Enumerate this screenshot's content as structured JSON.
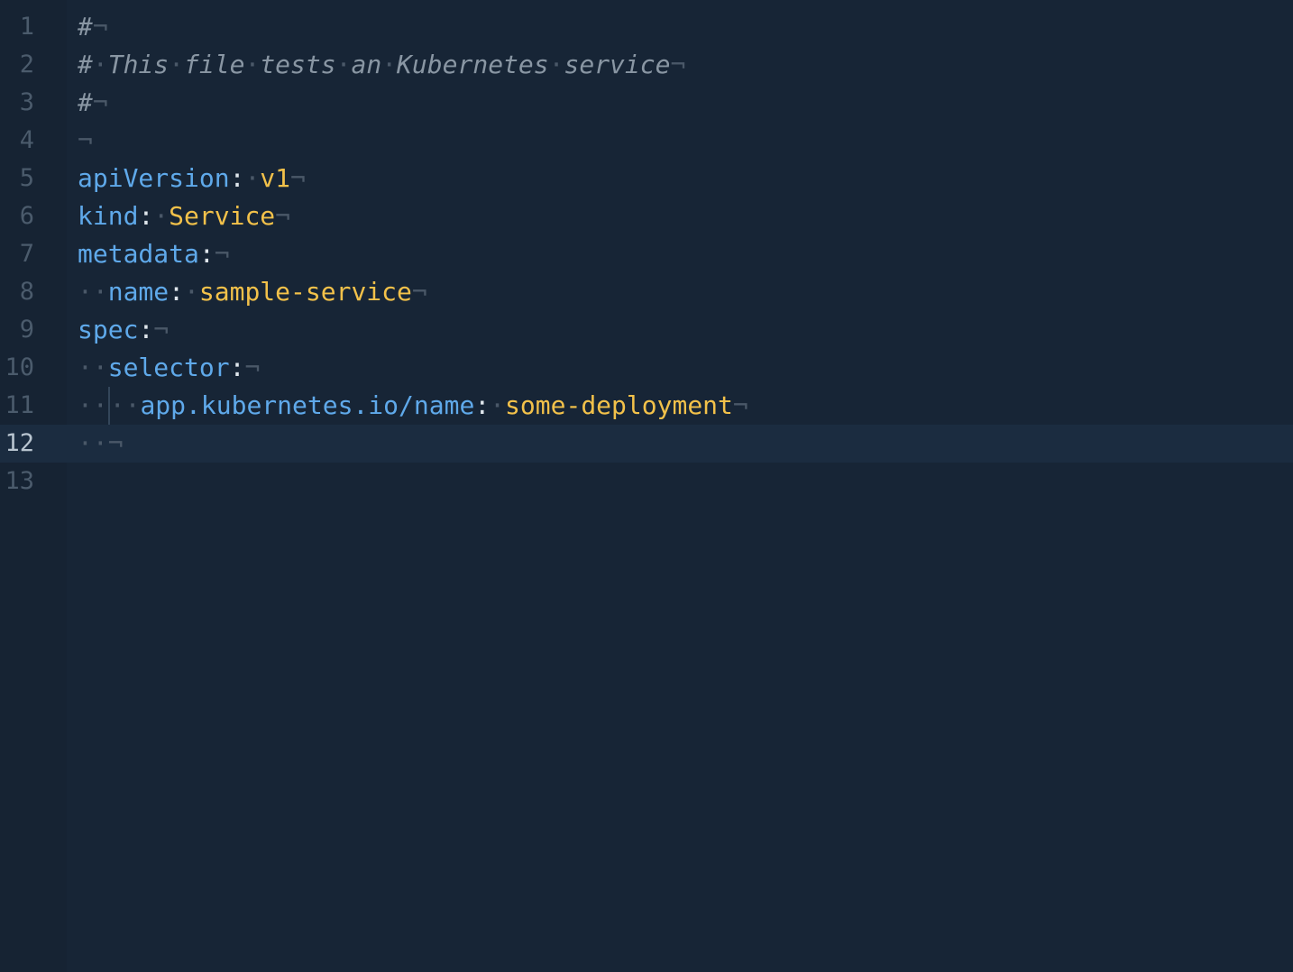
{
  "editor": {
    "language": "yaml",
    "current_line": 12,
    "colors": {
      "background": "#172536",
      "gutter": "#162333",
      "current_line": "#1b2c40",
      "line_number": "#4b5b6c",
      "line_number_active": "#b8c4cf",
      "comment": "#8996a3",
      "key": "#5fa9ea",
      "value": "#f2c14a",
      "whitespace_marker": "#4a5868"
    },
    "whitespace_marker": "·",
    "eol_marker": "¬",
    "lines": [
      {
        "number": "1",
        "segments": [
          {
            "t": "comment",
            "v": "#"
          },
          {
            "t": "eol",
            "v": "¬"
          }
        ]
      },
      {
        "number": "2",
        "segments": [
          {
            "t": "comment",
            "v": "#"
          },
          {
            "t": "ws",
            "v": "·"
          },
          {
            "t": "comment",
            "v": "This"
          },
          {
            "t": "ws",
            "v": "·"
          },
          {
            "t": "comment",
            "v": "file"
          },
          {
            "t": "ws",
            "v": "·"
          },
          {
            "t": "comment",
            "v": "tests"
          },
          {
            "t": "ws",
            "v": "·"
          },
          {
            "t": "comment",
            "v": "an"
          },
          {
            "t": "ws",
            "v": "·"
          },
          {
            "t": "comment",
            "v": "Kubernetes"
          },
          {
            "t": "ws",
            "v": "·"
          },
          {
            "t": "comment",
            "v": "service"
          },
          {
            "t": "eol",
            "v": "¬"
          }
        ]
      },
      {
        "number": "3",
        "segments": [
          {
            "t": "comment",
            "v": "#"
          },
          {
            "t": "eol",
            "v": "¬"
          }
        ]
      },
      {
        "number": "4",
        "segments": [
          {
            "t": "eol",
            "v": "¬"
          }
        ]
      },
      {
        "number": "5",
        "segments": [
          {
            "t": "key",
            "v": "apiVersion"
          },
          {
            "t": "colon",
            "v": ":"
          },
          {
            "t": "ws",
            "v": "·"
          },
          {
            "t": "val",
            "v": "v1"
          },
          {
            "t": "eol",
            "v": "¬"
          }
        ]
      },
      {
        "number": "6",
        "segments": [
          {
            "t": "key",
            "v": "kind"
          },
          {
            "t": "colon",
            "v": ":"
          },
          {
            "t": "ws",
            "v": "·"
          },
          {
            "t": "val",
            "v": "Service"
          },
          {
            "t": "eol",
            "v": "¬"
          }
        ]
      },
      {
        "number": "7",
        "segments": [
          {
            "t": "key",
            "v": "metadata"
          },
          {
            "t": "colon",
            "v": ":"
          },
          {
            "t": "eol",
            "v": "¬"
          }
        ]
      },
      {
        "number": "8",
        "segments": [
          {
            "t": "ws",
            "v": "··"
          },
          {
            "t": "key",
            "v": "name"
          },
          {
            "t": "colon",
            "v": ":"
          },
          {
            "t": "ws",
            "v": "·"
          },
          {
            "t": "val",
            "v": "sample-service"
          },
          {
            "t": "eol",
            "v": "¬"
          }
        ]
      },
      {
        "number": "9",
        "segments": [
          {
            "t": "key",
            "v": "spec"
          },
          {
            "t": "colon",
            "v": ":"
          },
          {
            "t": "eol",
            "v": "¬"
          }
        ]
      },
      {
        "number": "10",
        "segments": [
          {
            "t": "ws",
            "v": "··"
          },
          {
            "t": "key",
            "v": "selector"
          },
          {
            "t": "colon",
            "v": ":"
          },
          {
            "t": "eol",
            "v": "¬"
          }
        ]
      },
      {
        "number": "11",
        "segments": [
          {
            "t": "ws",
            "v": "··"
          },
          {
            "t": "guide",
            "v": ""
          },
          {
            "t": "ws",
            "v": "··"
          },
          {
            "t": "key",
            "v": "app.kubernetes.io/name"
          },
          {
            "t": "colon",
            "v": ":"
          },
          {
            "t": "ws",
            "v": "·"
          },
          {
            "t": "val",
            "v": "some-deployment"
          },
          {
            "t": "eol",
            "v": "¬"
          }
        ]
      },
      {
        "number": "12",
        "segments": [
          {
            "t": "ws",
            "v": "··"
          },
          {
            "t": "eol",
            "v": "¬"
          }
        ]
      },
      {
        "number": "13",
        "segments": []
      }
    ]
  }
}
